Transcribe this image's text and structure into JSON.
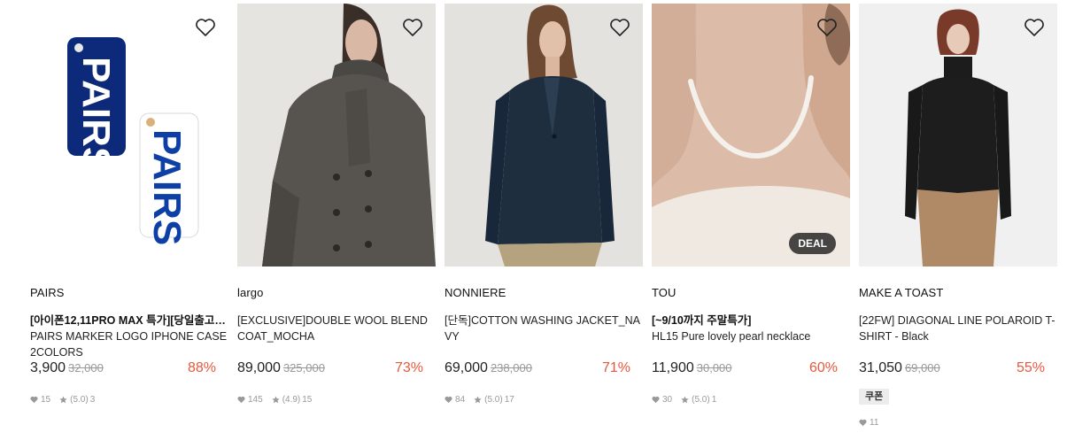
{
  "products": [
    {
      "brand": "PAIRS",
      "promo": "[아이폰12,11PRO MAX 특가][당일출고…",
      "name": "PAIRS MARKER LOGO IPHONE CASE 2COLORS",
      "price": "3,900",
      "original_price": "32,000",
      "discount": "88%",
      "likes": "15",
      "rating": "(5.0)",
      "reviews": "3",
      "image_icon": "phone-case-image",
      "image_text": "PAIRS"
    },
    {
      "brand": "largo",
      "promo": "",
      "name": "[EXCLUSIVE]DOUBLE WOOL BLEND COAT_MOCHA",
      "price": "89,000",
      "original_price": "325,000",
      "discount": "73%",
      "likes": "145",
      "rating": "(4.9)",
      "reviews": "15",
      "image_icon": "coat-model-image"
    },
    {
      "brand": "NONNIERE",
      "promo": "",
      "name": "[단독]COTTON WASHING JACKET_NAVY",
      "price": "69,000",
      "original_price": "238,000",
      "discount": "71%",
      "likes": "84",
      "rating": "(5.0)",
      "reviews": "17",
      "image_icon": "jacket-model-image"
    },
    {
      "brand": "TOU",
      "promo": "[~9/10까지 주말특가]",
      "name": "HL15 Pure lovely pearl necklace",
      "price": "11,900",
      "original_price": "30,000",
      "discount": "60%",
      "likes": "30",
      "rating": "(5.0)",
      "reviews": "1",
      "badge": "DEAL",
      "image_icon": "pearl-necklace-image"
    },
    {
      "brand": "MAKE A TOAST",
      "promo": "",
      "name": "[22FW] DIAGONAL LINE POLAROID T-SHIRT - Black",
      "price": "31,050",
      "original_price": "69,000",
      "discount": "55%",
      "coupon": "쿠폰",
      "likes": "11",
      "image_icon": "tshirt-model-image"
    }
  ],
  "colors": {
    "discount": "#e8573e",
    "strike": "#999999",
    "brand_case_blue": "#0d2a7a"
  }
}
